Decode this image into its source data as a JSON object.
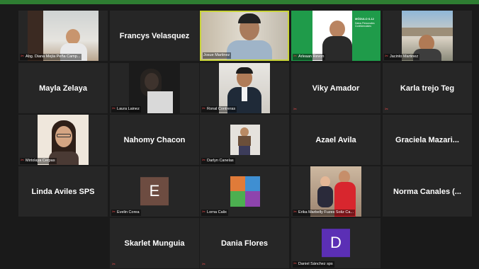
{
  "app": {
    "accent": "#2e7d32",
    "active_speaker_border": "#c9d43a",
    "muted_icon_color": "#e04848"
  },
  "participants": {
    "p1": {
      "label": "Abg. Diana Mejía Peña  Camp...",
      "muted": true,
      "video": true
    },
    "p2": {
      "name": "Francys Velasquez",
      "muted": false,
      "video": false
    },
    "p3": {
      "label": "Josue Martinez",
      "muted": false,
      "video": true,
      "active_speaker": true
    },
    "p4": {
      "label": "Arleaan Revon",
      "muted": true,
      "video": true,
      "slide_title": "MÓDULO 6-12",
      "slide_subtitle": "Datos Personales Confidenciales"
    },
    "p5": {
      "label": "Jacinto Martinez",
      "muted": true,
      "video": true
    },
    "p6": {
      "name": "Mayla Zelaya",
      "muted": false,
      "video": false
    },
    "p7": {
      "label": "Laura Lainez",
      "muted": true,
      "video": true
    },
    "p8": {
      "label": "Ronal Contreras",
      "muted": true,
      "video": true
    },
    "p9": {
      "name": "Viky Amador",
      "muted": true,
      "video": false
    },
    "p10": {
      "name": "Karla trejo Teg",
      "muted": true,
      "video": false
    },
    "p11": {
      "label": "Mirtolaya Cerpas",
      "muted": true,
      "video": true
    },
    "p12": {
      "name": "Nahomy Chacon",
      "muted": false,
      "video": false
    },
    "p13": {
      "label": "Darlyn Canelas",
      "muted": true,
      "video": true
    },
    "p14": {
      "name": "Azael Avila",
      "muted": false,
      "video": false
    },
    "p15": {
      "name": "Graciela  Mazari...",
      "muted": false,
      "video": false
    },
    "p16": {
      "name": "Linda Aviles SPS",
      "muted": false,
      "video": false
    },
    "p17": {
      "label": "Evelin Corea",
      "muted": true,
      "video": false,
      "avatar_letter": "E",
      "avatar_color": "#6d4c41"
    },
    "p18": {
      "label": "Lorna Calix",
      "muted": true,
      "video": true
    },
    "p19": {
      "label": "Erika Marbelly Fuzes Soliz Ca...",
      "muted": true,
      "video": true
    },
    "p20": {
      "name": "Norma  Canales  (...",
      "muted": false,
      "video": false
    },
    "p21": {
      "name": "Skarlet Munguia",
      "muted": true,
      "video": false
    },
    "p22": {
      "name": "Dania Flores",
      "muted": true,
      "video": false
    },
    "p23": {
      "label": "Daniel Sánchez sps",
      "muted": true,
      "video": false,
      "avatar_letter": "D",
      "avatar_color": "#5b2fb5"
    }
  }
}
